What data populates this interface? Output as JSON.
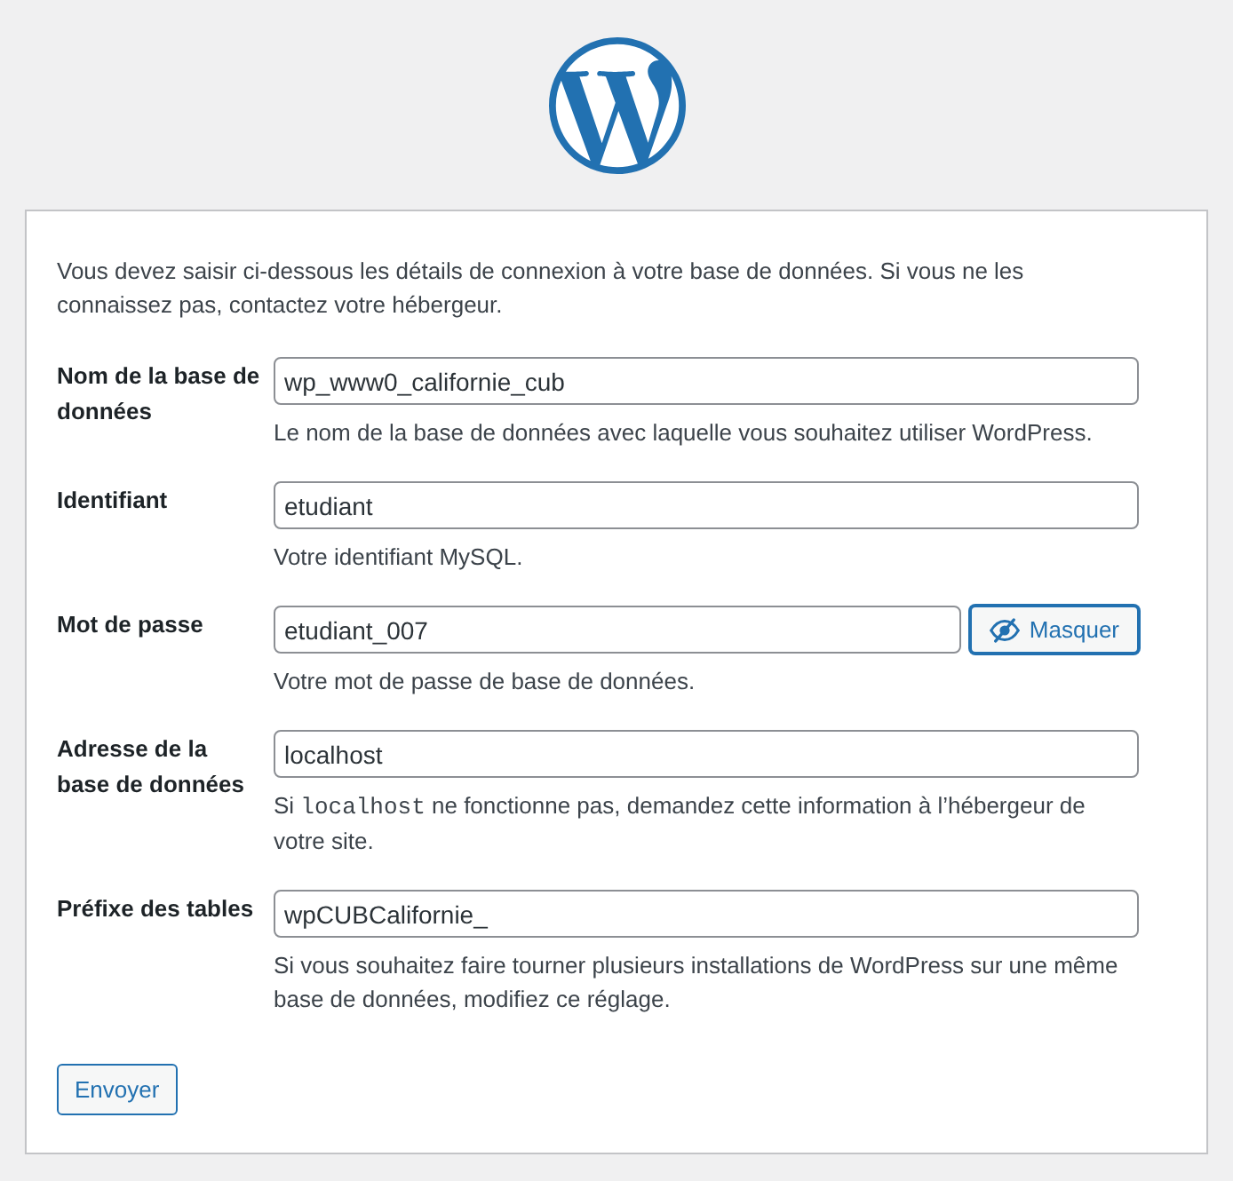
{
  "intro": "Vous devez saisir ci-dessous les détails de connexion à votre base de données. Si vous ne les connaissez pas, contactez votre hébergeur.",
  "fields": [
    {
      "label": "Nom de la base de données",
      "value": "wp_www0_californie_cub",
      "description": [
        {
          "kind": "text",
          "text": "Le nom de la base de données avec laquelle vous souhaitez utiliser WordPress."
        }
      ]
    },
    {
      "label": "Identifiant",
      "value": "etudiant",
      "description": [
        {
          "kind": "text",
          "text": "Votre identifiant MySQL."
        }
      ]
    },
    {
      "label": "Mot de passe",
      "value": "etudiant_007",
      "revealed": true,
      "toggle": {
        "label": "Masquer",
        "focused": true
      },
      "description": [
        {
          "kind": "text",
          "text": "Votre mot de passe de base de données."
        }
      ]
    },
    {
      "label": "Adresse de la base de données",
      "value": "localhost",
      "description": [
        {
          "kind": "text",
          "text": "Si "
        },
        {
          "kind": "code",
          "text": "localhost"
        },
        {
          "kind": "text",
          "text": " ne fonctionne pas, demandez cette information à l’hébergeur de votre site."
        }
      ]
    },
    {
      "label": "Préfixe des tables",
      "value": "wpCUBCalifornie_",
      "description": [
        {
          "kind": "text",
          "text": "Si vous souhaitez faire tourner plusieurs installations de WordPress sur une même base de données, modifiez ce réglage."
        }
      ]
    }
  ],
  "submit": "Envoyer"
}
